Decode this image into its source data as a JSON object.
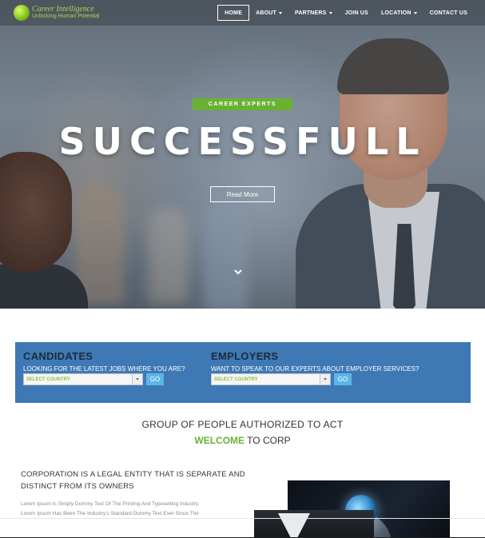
{
  "brand": {
    "name": "Career Intelligence",
    "tagline": "Unlocking Human Potential"
  },
  "nav": {
    "items": [
      {
        "label": "HOME",
        "active": true,
        "dropdown": false
      },
      {
        "label": "ABOUT",
        "active": false,
        "dropdown": true
      },
      {
        "label": "PARTNERS",
        "active": false,
        "dropdown": true
      },
      {
        "label": "JOIN US",
        "active": false,
        "dropdown": false
      },
      {
        "label": "LOCATION",
        "active": false,
        "dropdown": true
      },
      {
        "label": "CONTACT US",
        "active": false,
        "dropdown": false
      }
    ]
  },
  "hero": {
    "badge": "CAREER EXPERTS",
    "title": "SUCCESSFULL",
    "button": "Read More"
  },
  "search": {
    "candidates": {
      "heading": "CANDIDATES",
      "prompt": "LOOKING FOR THE LATEST JOBS WHERE YOU ARE?",
      "select": "SELECT COUNTRY",
      "go": "GO"
    },
    "employers": {
      "heading": "EMPLOYERS",
      "prompt": "WANT TO SPEAK TO OUR EXPERTS ABOUT EMPLOYER SERVICES?",
      "select": "SELECT COUNTRY",
      "go": "GO"
    }
  },
  "about": {
    "line1": "GROUP OF PEOPLE AUTHORIZED TO ACT",
    "welcome_highlight": "WELCOME",
    "welcome_rest": " TO CORP",
    "heading": "CORPORATION IS A LEGAL ENTITY THAT IS SEPARATE AND DISTINCT FROM ITS OWNERS",
    "body_line1": "Lorem Ipsum Is Simply Dummy Text Of The Printing And Typesetting Industry.",
    "body_line2": "Lorem Ipsum Has Been The Industry's Standard Dummy Text Ever Since The"
  },
  "colors": {
    "accent_green": "#6ab133",
    "panel_blue": "#3e79b5",
    "go_button": "#5cb6e6"
  }
}
